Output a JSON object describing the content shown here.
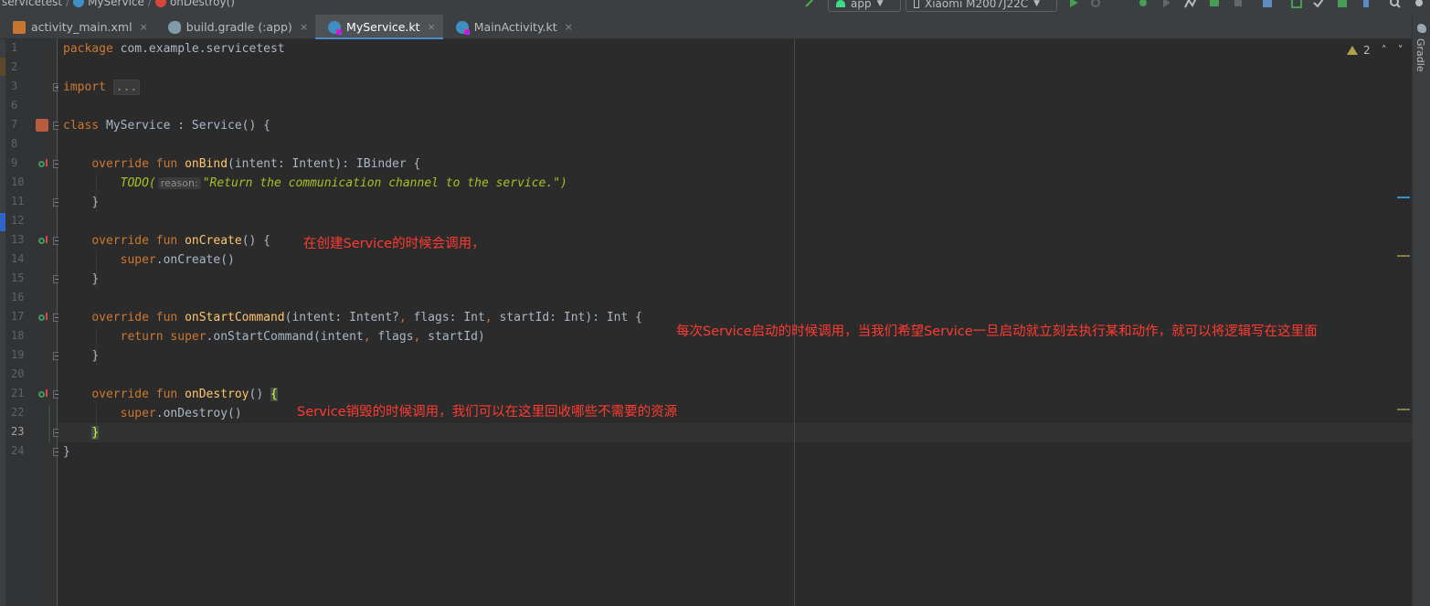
{
  "breadcrumb": {
    "project": "servicetest",
    "cls": "MyService",
    "method": "onDestroy()"
  },
  "toolbar": {
    "run_config": "app",
    "device": "Xiaomi M2007J22C"
  },
  "tabs": [
    {
      "label": "activity_main.xml",
      "icon": "xml-file-icon",
      "active": false
    },
    {
      "label": "build.gradle (:app)",
      "icon": "gradle-file-icon",
      "active": false
    },
    {
      "label": "MyService.kt",
      "icon": "kotlin-file-icon",
      "active": true
    },
    {
      "label": "MainActivity.kt",
      "icon": "kotlin-file-icon",
      "active": false
    }
  ],
  "tab_close": "×",
  "inspection": {
    "warning_count": "2"
  },
  "gutter": {
    "line_numbers": [
      "1",
      "2",
      "3",
      "6",
      "7",
      "8",
      "9",
      "10",
      "11",
      "12",
      "13",
      "14",
      "15",
      "16",
      "17",
      "18",
      "19",
      "20",
      "21",
      "22",
      "23",
      "24"
    ],
    "current_line": "23"
  },
  "code": {
    "l1_kw": "package",
    "l1_rest": " com.example.servicetest",
    "l3_kw": "import",
    "l3_collapsed": "...",
    "l7_kw": "class",
    "l7_rest": " MyService : Service() {",
    "l9_kw": "override fun",
    "l9_fn": "onBind",
    "l9_rest": "(intent: Intent): IBinder {",
    "l10_todo": "TODO(",
    "l10_hint": "reason:",
    "l10_str": "\"Return the communication channel to the service.\")",
    "l11": "}",
    "l13_kw": "override fun",
    "l13_fn": "onCreate",
    "l13_rest": "() {",
    "l14_kw": "super",
    "l14_rest": ".onCreate()",
    "l15": "}",
    "l17_kw": "override fun",
    "l17_fn": "onStartCommand",
    "l17_a": "(intent: Intent?",
    "l17_b": " flags: Int",
    "l17_c": " startId: Int): Int {",
    "l18_kw": "return super",
    "l18_a": ".onStartCommand(intent",
    "l18_b": " flags",
    "l18_c": " startId)",
    "l19": "}",
    "l21_kw": "override fun",
    "l21_fn": "onDestroy",
    "l21_rest": "() ",
    "l21_brace": "{",
    "l22_kw": "super",
    "l22_rest": ".onDestroy()",
    "l23_brace": "}",
    "l24": "}",
    "comma": ","
  },
  "annotations": {
    "on_create": "在创建Service的时候会调用，",
    "on_start_command": "每次Service启动的时候调用，当我们希望Service一旦启动就立刻去执行某和动作，就可以将逻辑写在这里面",
    "on_destroy": "Service销毁的时候调用，我们可以在这里回收哪些不需要的资源"
  },
  "right_panel": {
    "gradle": "Gradle"
  },
  "colors": {
    "keyword": "#cc7832",
    "function": "#ffc66d",
    "todo": "#a8c023",
    "annotation": "#ff3b30",
    "tab_accent": "#4a88c7"
  }
}
